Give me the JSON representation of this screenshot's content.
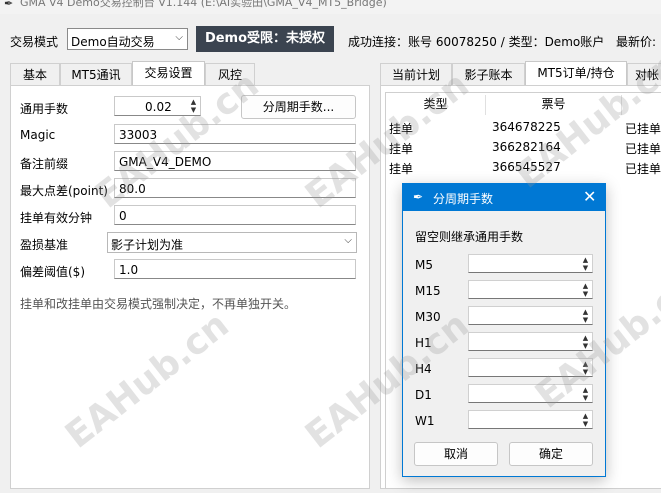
{
  "window": {
    "title": "GMA V4 Demo交易控制台 V1.144  (E:\\AI实验田\\GMA_V4_MT5_Bridge)"
  },
  "top": {
    "mode_label": "交易模式",
    "mode_value": "Demo自动交易",
    "badge": "Demo受限：未授权",
    "status": "成功连接：账号 60078250 / 类型：Demo账户",
    "latest_label": "最新价:"
  },
  "left_tabs": [
    "基本",
    "MT5通讯",
    "交易设置",
    "风控"
  ],
  "form": {
    "lot_label": "通用手数",
    "lot_value": "0.02",
    "period_button": "分周期手数...",
    "magic_label": "Magic",
    "magic_value": "33003",
    "prefix_label": "备注前缀",
    "prefix_value": "GMA_V4_DEMO",
    "slippage_label": "最大点差(point)",
    "slippage_value": "80.0",
    "pending_label": "挂单有效分钟",
    "pending_value": "0",
    "pnl_label": "盈损基准",
    "pnl_value": "影子计划为准",
    "dev_label": "偏差阈值($)",
    "dev_value": "1.0",
    "note": "挂单和改挂单由交易模式强制决定，不再单独开关。"
  },
  "right_tabs": [
    "当前计划",
    "影子账本",
    "MT5订单/持仓",
    "对帐"
  ],
  "orders": {
    "headers": [
      "类型",
      "票号"
    ],
    "rows": [
      {
        "type": "挂单",
        "ticket": "364678225",
        "state": "已挂单"
      },
      {
        "type": "挂单",
        "ticket": "366282164",
        "state": "已挂单"
      },
      {
        "type": "挂单",
        "ticket": "366545527",
        "state": "已挂单"
      }
    ]
  },
  "dialog": {
    "title": "分周期手数",
    "hint": "留空则继承通用手数",
    "periods": [
      "M5",
      "M15",
      "M30",
      "H1",
      "H4",
      "D1",
      "W1"
    ],
    "cancel": "取消",
    "ok": "确定"
  },
  "watermark": "EAHub.cn",
  "colors": {
    "accent": "#0078d4",
    "badge": "#3b4450"
  }
}
